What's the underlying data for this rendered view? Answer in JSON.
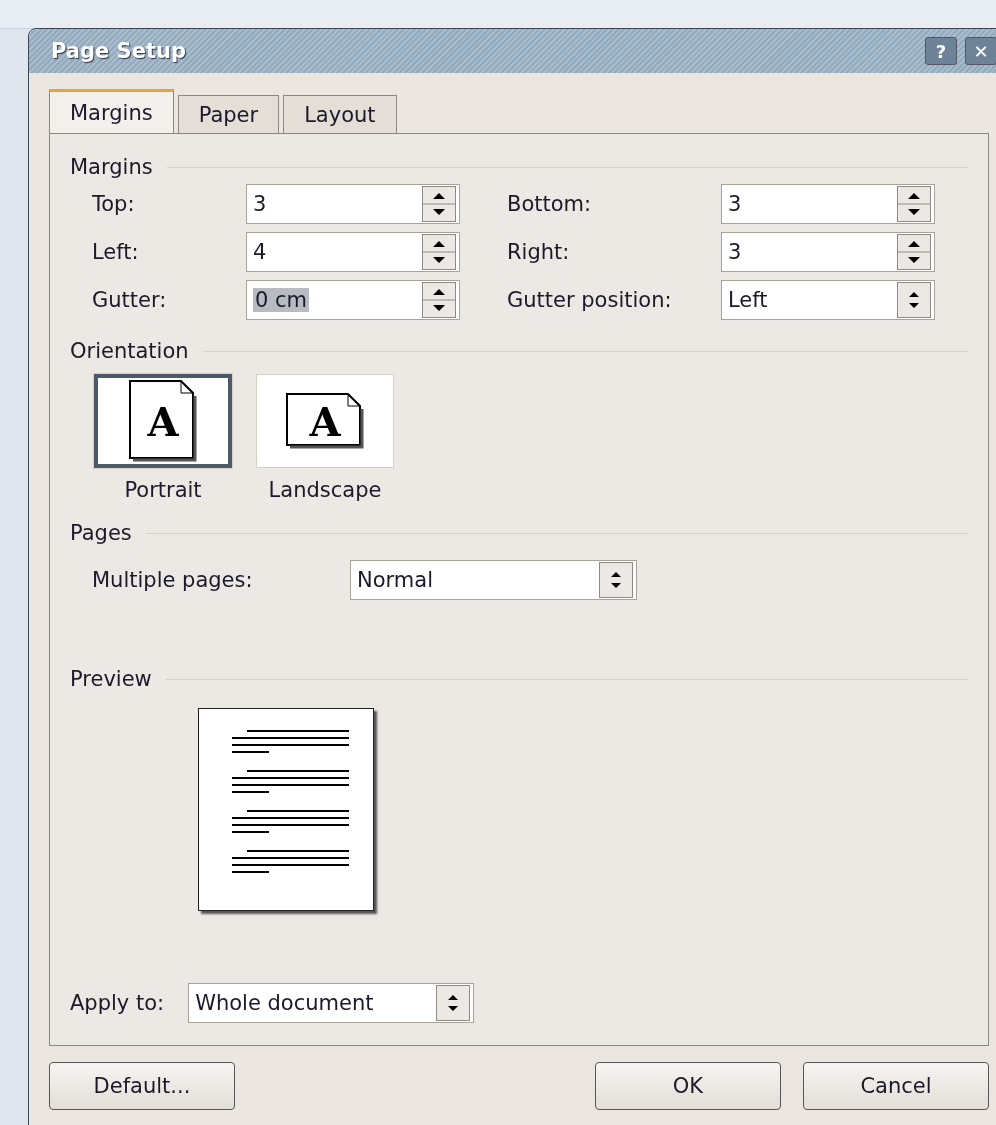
{
  "window": {
    "title": "Page Setup",
    "title_buttons": [
      "?",
      "✕"
    ]
  },
  "tabs": [
    {
      "label": "Margins",
      "selected": true
    },
    {
      "label": "Paper",
      "selected": false
    },
    {
      "label": "Layout",
      "selected": false
    }
  ],
  "margins": {
    "heading": "Margins",
    "fields": [
      {
        "label": "Top:",
        "value": "3",
        "kind": "spin",
        "value_selected": false
      },
      {
        "label": "Bottom:",
        "value": "3",
        "kind": "spin",
        "value_selected": false
      },
      {
        "label": "Left:",
        "value": "4",
        "kind": "spin",
        "value_selected": false
      },
      {
        "label": "Right:",
        "value": "3",
        "kind": "spin",
        "value_selected": false
      },
      {
        "label": "Gutter:",
        "value": "0 cm",
        "kind": "spin",
        "value_selected": true
      },
      {
        "label": "Gutter position:",
        "value": "Left",
        "kind": "combo",
        "value_selected": false
      }
    ]
  },
  "orientation": {
    "heading": "Orientation",
    "options": [
      {
        "label": "Portrait",
        "glyph": "A",
        "kind": "portrait",
        "selected": true
      },
      {
        "label": "Landscape",
        "glyph": "A",
        "kind": "landscape",
        "selected": false
      }
    ]
  },
  "pages": {
    "heading": "Pages",
    "label": "Multiple pages:",
    "value": "Normal"
  },
  "preview": {
    "heading": "Preview"
  },
  "apply_to": {
    "label": "Apply to:",
    "value": "Whole document"
  },
  "buttons": [
    {
      "label": "Default...",
      "kind": "left"
    },
    {
      "label": "OK",
      "kind": "right"
    },
    {
      "label": "Cancel",
      "kind": "right"
    }
  ]
}
